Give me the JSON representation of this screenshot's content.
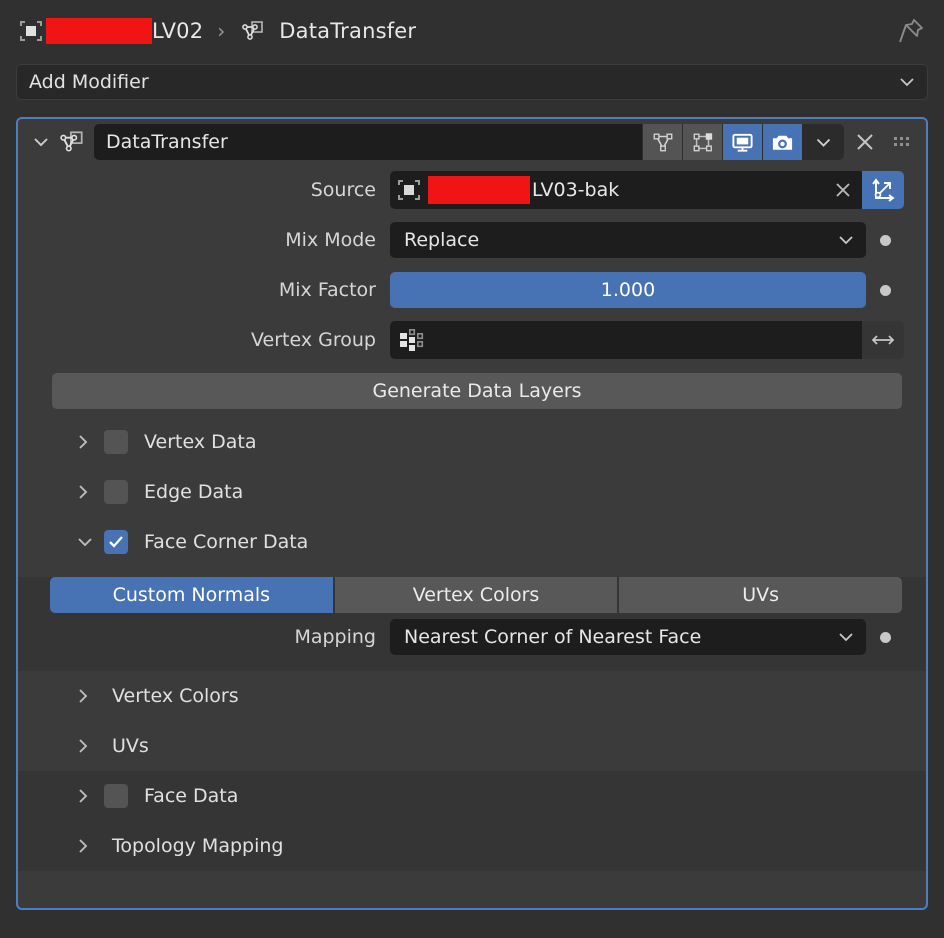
{
  "breadcrumb": {
    "object_icon": "object-icon",
    "object_name": "LV02",
    "separator": "›",
    "modifier_icon": "data-transfer-icon",
    "modifier_name": "DataTransfer",
    "pin_icon": "pin-icon",
    "color_block": "#f01414"
  },
  "add_modifier": {
    "label": "Add Modifier",
    "chevron": "chevron-down-icon"
  },
  "modifier": {
    "expand_chevron": "chevron-down-icon",
    "icon": "data-transfer-icon",
    "name": "DataTransfer",
    "toggles": [
      {
        "name": "show-in-edit-mode-toggle",
        "icon": "edit-mode-icon",
        "active": false
      },
      {
        "name": "on-cage-toggle",
        "icon": "on-cage-icon",
        "active": false
      },
      {
        "name": "show-in-viewport-toggle",
        "icon": "display-monitor-icon",
        "active": true
      },
      {
        "name": "show-in-render-toggle",
        "icon": "camera-icon",
        "active": true
      }
    ],
    "extras_chevron": "chevron-down-icon",
    "close_icon": "close-x-icon",
    "grip_icon": "drag-grip-icon",
    "accent_color": "#4c7ec0"
  },
  "fields": {
    "source": {
      "label": "Source",
      "object_icon": "object-icon",
      "color_block": "#f01414",
      "value": "LV03-bak",
      "clear_icon": "close-x-icon",
      "transform_icon": "object-transform-icon"
    },
    "mix_mode": {
      "label": "Mix Mode",
      "value": "Replace",
      "chevron": "chevron-down-icon",
      "decorator": "animate-dot"
    },
    "mix_factor": {
      "label": "Mix Factor",
      "value": "1.000",
      "fill_percent": 100,
      "decorator": "animate-dot"
    },
    "vertex_group": {
      "label": "Vertex Group",
      "value": "",
      "group_icon": "vertex-group-icon",
      "invert_icon": "arrows-left-right-icon"
    }
  },
  "generate_button": {
    "label": "Generate Data Layers"
  },
  "sections": [
    {
      "label": "Vertex Data",
      "chevron": "chevron-right-icon",
      "has_checkbox": true,
      "checked": false,
      "expanded": false,
      "band": "light"
    },
    {
      "label": "Edge Data",
      "chevron": "chevron-right-icon",
      "has_checkbox": true,
      "checked": false,
      "expanded": false,
      "band": "light"
    },
    {
      "label": "Face Corner Data",
      "chevron": "chevron-down-icon",
      "has_checkbox": true,
      "checked": true,
      "expanded": true,
      "band": "light"
    }
  ],
  "face_corner_data": {
    "tabs": [
      {
        "label": "Custom Normals",
        "active": true
      },
      {
        "label": "Vertex Colors",
        "active": false
      },
      {
        "label": "UVs",
        "active": false
      }
    ],
    "mapping": {
      "label": "Mapping",
      "value": "Nearest Corner of Nearest Face",
      "chevron": "chevron-down-icon",
      "decorator": "animate-dot"
    }
  },
  "sub_sections": [
    {
      "label": "Vertex Colors",
      "chevron": "chevron-right-icon",
      "has_checkbox": false,
      "checked": false,
      "band": "light"
    },
    {
      "label": "UVs",
      "chevron": "chevron-right-icon",
      "has_checkbox": false,
      "checked": false,
      "band": "light"
    }
  ],
  "bottom_sections": [
    {
      "label": "Face Data",
      "chevron": "chevron-right-icon",
      "has_checkbox": true,
      "checked": false,
      "band": "dark"
    },
    {
      "label": "Topology Mapping",
      "chevron": "chevron-right-icon",
      "has_checkbox": false,
      "checked": false,
      "band": "dark"
    }
  ]
}
